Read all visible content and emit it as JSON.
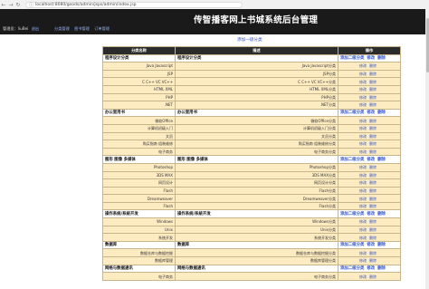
{
  "browser": {
    "url": "localhost:8080/goods/admin/jsps/admin/index.jsp"
  },
  "header": {
    "title": "传智播客网上书城系统后台管理",
    "user_label": "管理员：liuBei",
    "logout_label": "退出",
    "nav": [
      "分类管理",
      "图书管理",
      "订单管理"
    ]
  },
  "add_top_label": "添加一级分类",
  "table": {
    "columns": [
      "分类名称",
      "描述",
      "操作"
    ],
    "rows": [
      {
        "kind": "parent",
        "name": "程序设计分类",
        "desc": "程序设计分类",
        "ops": [
          "添加二级分类",
          "修改",
          "删除"
        ]
      },
      {
        "kind": "child",
        "name": "Java Javascript",
        "desc": "Java Javascript分类",
        "ops": [
          "修改",
          "删除"
        ]
      },
      {
        "kind": "child",
        "name": "JSP",
        "desc": "JSP分类",
        "ops": [
          "修改",
          "删除"
        ]
      },
      {
        "kind": "child",
        "name": "C C++ VC VC++",
        "desc": "C C++ VC VC++分类",
        "ops": [
          "修改",
          "删除"
        ]
      },
      {
        "kind": "child",
        "name": "HTML XML",
        "desc": "HTML XML分类",
        "ops": [
          "修改",
          "删除"
        ]
      },
      {
        "kind": "child",
        "name": "PHP",
        "desc": "PHP分类",
        "ops": [
          "修改",
          "删除"
        ]
      },
      {
        "kind": "child",
        "name": ".NET",
        "desc": ".NET分类",
        "ops": [
          "修改",
          "删除"
        ]
      },
      {
        "kind": "parent",
        "name": "办公室用书",
        "desc": "办公室用书",
        "ops": [
          "添加二级分类",
          "修改",
          "删除"
        ]
      },
      {
        "kind": "child",
        "name": "微软Office",
        "desc": "微软Office分类",
        "ops": [
          "修改",
          "删除"
        ]
      },
      {
        "kind": "child",
        "name": "计算机初级入门",
        "desc": "计算机初级入门分类",
        "ops": [
          "修改",
          "删除"
        ]
      },
      {
        "kind": "child",
        "name": "文员",
        "desc": "文员分类",
        "ops": [
          "修改",
          "删除"
        ]
      },
      {
        "kind": "child",
        "name": "购买指南 组装维修",
        "desc": "购买指南 组装维修分类",
        "ops": [
          "修改",
          "删除"
        ]
      },
      {
        "kind": "child",
        "name": "电子商务",
        "desc": "电子商务分类",
        "ops": [
          "修改",
          "删除"
        ]
      },
      {
        "kind": "parent",
        "name": "图形 图像 多媒体",
        "desc": "图形 图像 多媒体",
        "ops": [
          "添加二级分类",
          "修改",
          "删除"
        ]
      },
      {
        "kind": "child",
        "name": "Photoshop",
        "desc": "Photoshop分类",
        "ops": [
          "修改",
          "删除"
        ]
      },
      {
        "kind": "child",
        "name": "3DS MAX",
        "desc": "3DS MAX分类",
        "ops": [
          "修改",
          "删除"
        ]
      },
      {
        "kind": "child",
        "name": "网页设计",
        "desc": "网页设计分类",
        "ops": [
          "修改",
          "删除"
        ]
      },
      {
        "kind": "child",
        "name": "Flash",
        "desc": "Flash分类",
        "ops": [
          "修改",
          "删除"
        ]
      },
      {
        "kind": "child",
        "name": "Dreamweaver",
        "desc": "Dreamweaver分类",
        "ops": [
          "修改",
          "删除"
        ]
      },
      {
        "kind": "child",
        "name": "Flash",
        "desc": "Flash分类",
        "ops": [
          "修改",
          "删除"
        ]
      },
      {
        "kind": "parent",
        "name": "操作系统/系统开发",
        "desc": "操作系统/系统开发",
        "ops": [
          "添加二级分类",
          "修改",
          "删除"
        ]
      },
      {
        "kind": "child",
        "name": "Windows",
        "desc": "Windows分类",
        "ops": [
          "修改",
          "删除"
        ]
      },
      {
        "kind": "child",
        "name": "Unix",
        "desc": "Unix分类",
        "ops": [
          "修改",
          "删除"
        ]
      },
      {
        "kind": "child",
        "name": "系统开发",
        "desc": "系统开发分类",
        "ops": [
          "修改",
          "删除"
        ]
      },
      {
        "kind": "parent",
        "name": "数据库",
        "desc": "数据库",
        "ops": [
          "添加二级分类",
          "修改",
          "删除"
        ]
      },
      {
        "kind": "child",
        "name": "数据仓库与数据挖掘",
        "desc": "数据仓库与数据挖掘分类",
        "ops": [
          "修改",
          "删除"
        ]
      },
      {
        "kind": "child",
        "name": "数据库管理",
        "desc": "数据库管理分类",
        "ops": [
          "修改",
          "删除"
        ]
      },
      {
        "kind": "parent",
        "name": "网络与数据通讯",
        "desc": "网络与数据通讯",
        "ops": [
          "添加二级分类",
          "修改",
          "删除"
        ]
      },
      {
        "kind": "child",
        "name": "电子商务",
        "desc": "电子商务分类",
        "ops": [
          "修改",
          "删除"
        ]
      }
    ]
  },
  "colors": {
    "header_bg": "#1a1a1a",
    "child_row_bg": "#fdebc2",
    "link": "#3355cc"
  }
}
